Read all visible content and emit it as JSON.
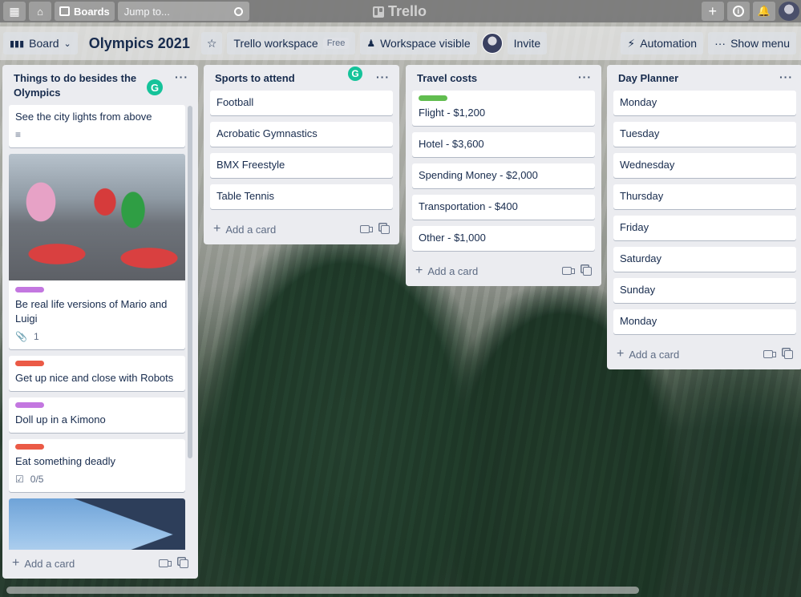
{
  "topbar": {
    "boards_label": "Boards",
    "search_placeholder": "Jump to...",
    "logo_text": "Trello"
  },
  "boardbar": {
    "view_label": "Board",
    "title": "Olympics 2021",
    "workspace_label": "Trello workspace",
    "workspace_badge": "Free",
    "visibility_label": "Workspace visible",
    "invite_label": "Invite",
    "automation_label": "Automation",
    "menu_label": "Show menu"
  },
  "add_card_label": "Add a card",
  "lists": [
    {
      "title": "Things to do besides the Olympics",
      "cards": [
        {
          "text": "See the city lights from above",
          "has_description": true
        },
        {
          "text": "Be real life versions of Mario and Luigi",
          "label_color": "#c377e0",
          "attachments": "1",
          "has_cover": true
        },
        {
          "text": "Get up nice and close with Robots",
          "label_color": "#eb5a46"
        },
        {
          "text": "Doll up in a Kimono",
          "label_color": "#c377e0"
        },
        {
          "text": "Eat something deadly",
          "label_color": "#eb5a46",
          "checklist": "0/5"
        }
      ]
    },
    {
      "title": "Sports to attend",
      "cards": [
        {
          "text": "Football"
        },
        {
          "text": "Acrobatic Gymnastics"
        },
        {
          "text": "BMX Freestyle"
        },
        {
          "text": "Table Tennis"
        }
      ]
    },
    {
      "title": "Travel costs",
      "cards": [
        {
          "text": "Flight - $1,200",
          "label_color": "#61bd4f"
        },
        {
          "text": "Hotel - $3,600"
        },
        {
          "text": "Spending Money - $2,000"
        },
        {
          "text": "Transportation - $400"
        },
        {
          "text": "Other - $1,000"
        }
      ]
    },
    {
      "title": "Day Planner",
      "cards": [
        {
          "text": "Monday"
        },
        {
          "text": "Tuesday"
        },
        {
          "text": "Wednesday"
        },
        {
          "text": "Thursday"
        },
        {
          "text": "Friday"
        },
        {
          "text": "Saturday"
        },
        {
          "text": "Sunday"
        },
        {
          "text": "Monday"
        }
      ]
    }
  ],
  "colors": {
    "label_purple": "#c377e0",
    "label_red": "#eb5a46",
    "label_green": "#61bd4f",
    "grammarly": "#15c39a"
  }
}
